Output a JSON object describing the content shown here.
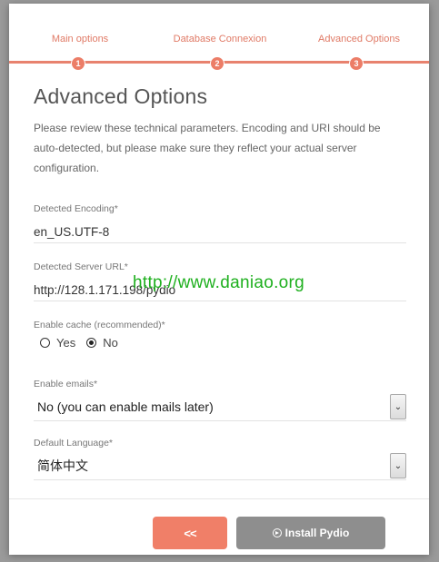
{
  "steps": [
    {
      "label": "Main options",
      "number": "1"
    },
    {
      "label": "Database Connexion",
      "number": "2"
    },
    {
      "label": "Advanced Options",
      "number": "3"
    }
  ],
  "page": {
    "title": "Advanced Options",
    "description": "Please review these technical parameters. Encoding and URI should be auto-detected, but please make sure they reflect your actual server configuration."
  },
  "fields": {
    "encoding": {
      "label": "Detected Encoding*",
      "value": "en_US.UTF-8"
    },
    "server_url": {
      "label": "Detected Server URL*",
      "value": "http://128.1.171.198/pydio"
    },
    "cache": {
      "label": "Enable cache (recommended)*",
      "yes_label": "Yes",
      "no_label": "No",
      "selected": "No"
    },
    "emails": {
      "label": "Enable emails*",
      "selected": "No (you can enable mails later)"
    },
    "language": {
      "label": "Default Language*",
      "selected": "简体中文"
    }
  },
  "watermark": "http://www.daniao.org",
  "footer": {
    "back_label": "<<",
    "install_label": "Install Pydio"
  },
  "colors": {
    "accent": "#ec7d67",
    "install_button": "#8e8e8e",
    "watermark": "#1fb01f"
  }
}
